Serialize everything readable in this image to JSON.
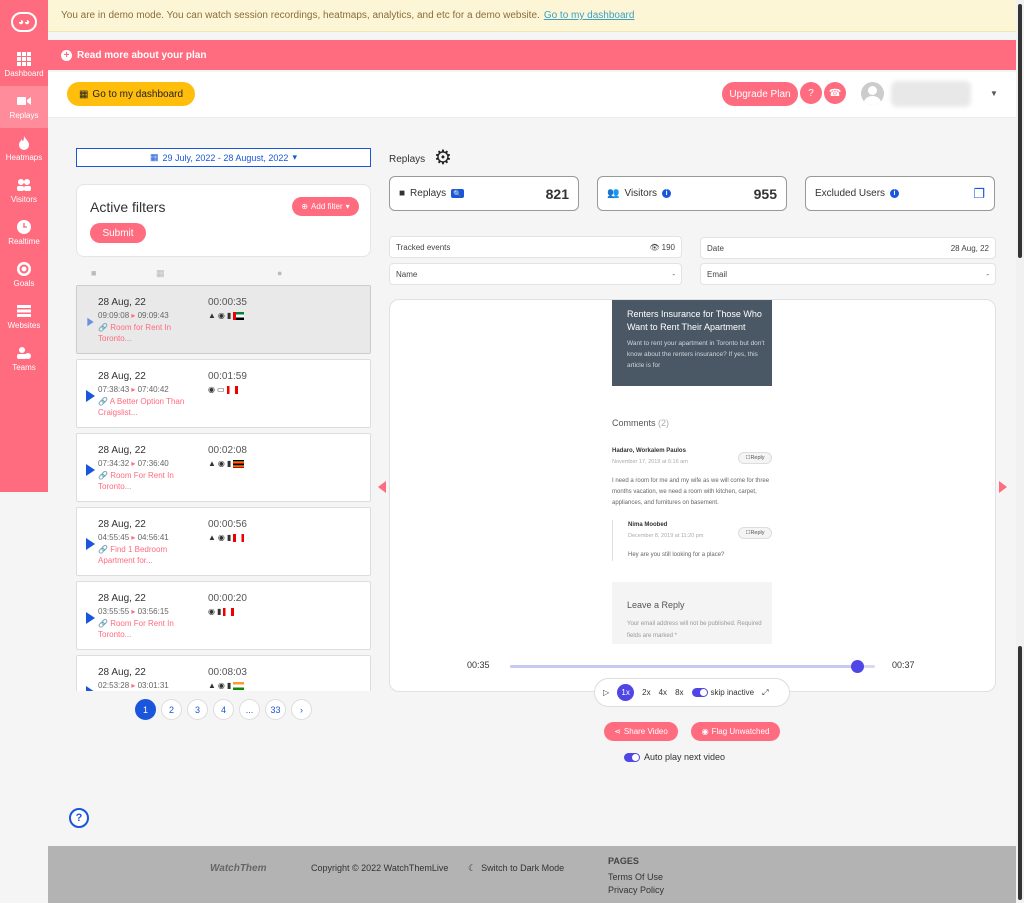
{
  "banner": {
    "demo_text": "You are in demo mode. You can watch session recordings, heatmaps, analytics, and etc for a demo website.",
    "demo_link": "Go to my dashboard",
    "plan_text": "Read more about your plan"
  },
  "sidebar": {
    "items": [
      {
        "label": "Dashboard",
        "icon": "grid-icon"
      },
      {
        "label": "Replays",
        "icon": "video-icon"
      },
      {
        "label": "Heatmaps",
        "icon": "fire-icon"
      },
      {
        "label": "Visitors",
        "icon": "users-icon"
      },
      {
        "label": "Realtime",
        "icon": "clock-icon"
      },
      {
        "label": "Goals",
        "icon": "target-icon"
      },
      {
        "label": "Websites",
        "icon": "server-icon"
      },
      {
        "label": "Teams",
        "icon": "team-icon"
      }
    ]
  },
  "header": {
    "dashboard_btn": "Go to my dashboard",
    "upgrade_btn": "Upgrade Plan"
  },
  "filters": {
    "date_range": "29 July, 2022 - 28 August, 2022",
    "title": "Active filters",
    "add_filter": "Add filter",
    "submit": "Submit"
  },
  "sessions": [
    {
      "date": "28 Aug, 22",
      "start": "09:09:08",
      "end": "09:09:43",
      "page": "Room for Rent In Toronto...",
      "duration": "00:00:35",
      "flag": "uae"
    },
    {
      "date": "28 Aug, 22",
      "start": "07:38:43",
      "end": "07:40:42",
      "page": "A Better Option Than Craigslist...",
      "duration": "00:01:59",
      "flag": "canada"
    },
    {
      "date": "28 Aug, 22",
      "start": "07:34:32",
      "end": "07:36:40",
      "page": "Room For Rent In Toronto...",
      "duration": "00:02:08",
      "flag": "uganda"
    },
    {
      "date": "28 Aug, 22",
      "start": "04:55:45",
      "end": "04:56:41",
      "page": "Find 1 Bedroom Apartment for...",
      "duration": "00:00:56",
      "flag": "canada"
    },
    {
      "date": "28 Aug, 22",
      "start": "03:55:55",
      "end": "03:56:15",
      "page": "Room For Rent In Toronto...",
      "duration": "00:00:20",
      "flag": "canada"
    },
    {
      "date": "28 Aug, 22",
      "start": "02:53:28",
      "end": "03:01:31",
      "page": "",
      "duration": "00:08:03",
      "flag": "india"
    }
  ],
  "pagination": [
    "1",
    "2",
    "3",
    "4",
    "...",
    "33"
  ],
  "stats": {
    "section_label": "Replays",
    "replays_label": "Replays",
    "replays_value": "821",
    "visitors_label": "Visitors",
    "visitors_value": "955",
    "excluded_label": "Excluded Users"
  },
  "meta": {
    "tracked_label": "Tracked events",
    "tracked_value": "190",
    "date_label": "Date",
    "date_value": "28 Aug, 22",
    "name_label": "Name",
    "name_value": "-",
    "email_label": "Email",
    "email_value": "-"
  },
  "video": {
    "article_title": "Renters Insurance for Those Who Want to Rent Their Apartment",
    "article_text": "Want to rent your apartment in Toronto but don't know about the renters insurance? If yes, this article is for",
    "comments_title": "Comments",
    "comments_count": "(2)",
    "c1_name": "Hadaro, Workalem Paulos",
    "c1_date": "November 17, 2019 at 6:16 am",
    "c1_text": "I need a room for me and my wife as we will come for three months vacation, we need a room with kitchen, carpet, appliances, and furnitures on basement.",
    "c2_name": "Nima Moobed",
    "c2_date": "December 8, 2019 at 11:20 pm",
    "c2_text": "Hey are you still looking for a place?",
    "reply": "Reply",
    "leave_title": "Leave a Reply",
    "leave_note": "Your email address will not be published. Required fields are marked *",
    "current_time": "00:35",
    "end_time": "00:37",
    "progress": 0.95
  },
  "controls": {
    "speeds": [
      "1x",
      "2x",
      "4x",
      "8x"
    ],
    "skip_label": "skip inactive"
  },
  "actions": {
    "share": "Share Video",
    "flag": "Flag Unwatched",
    "autoplay": "Auto play next video"
  },
  "footer": {
    "logo": "WatchThem",
    "copyright": "Copyright © 2022 WatchThemLive",
    "dark_mode": "Switch to Dark Mode",
    "pages_title": "PAGES",
    "terms": "Terms Of Use",
    "privacy": "Privacy Policy"
  },
  "colors": {
    "brand": "#ff6b7f",
    "accent": "#1a56db",
    "warning": "#ffbe0b"
  }
}
